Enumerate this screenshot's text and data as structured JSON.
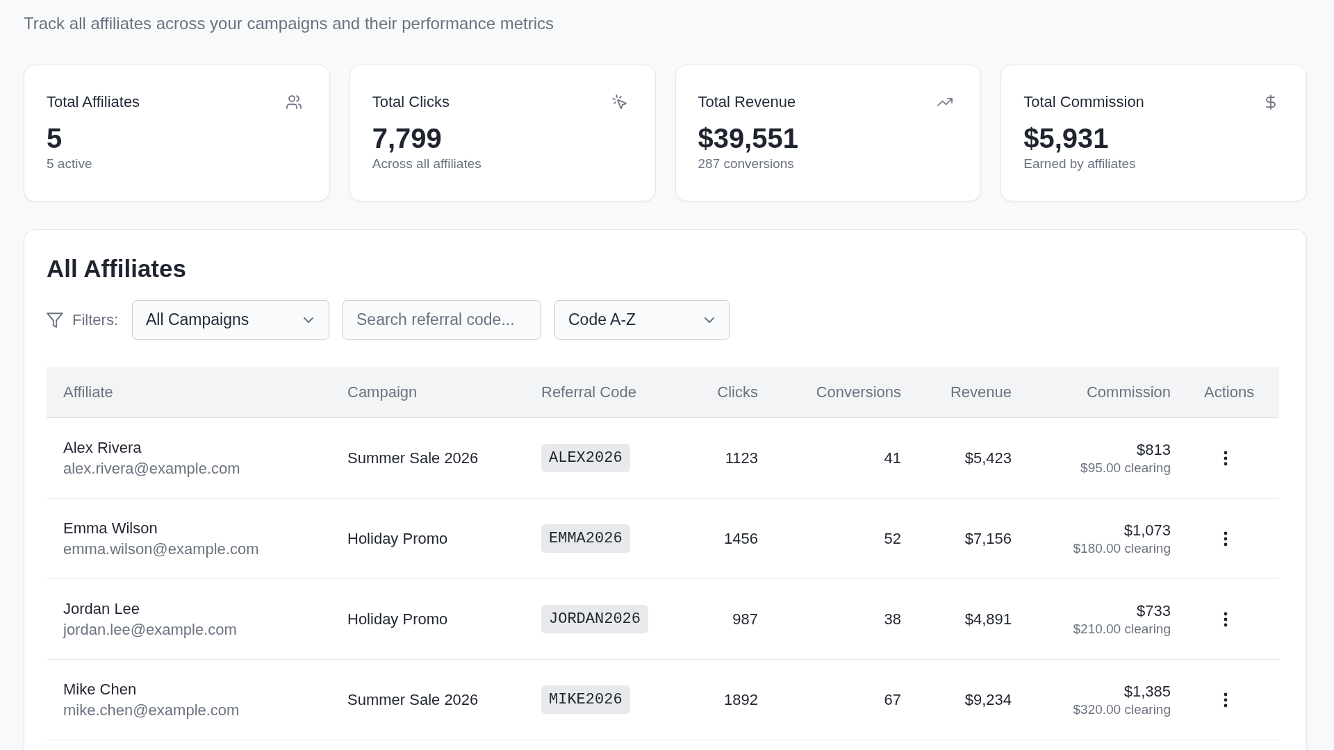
{
  "header": {
    "subtitle": "Track all affiliates across your campaigns and their performance metrics"
  },
  "stats": [
    {
      "kind": "affiliates",
      "label": "Total Affiliates",
      "value": "5",
      "note": "5 active"
    },
    {
      "kind": "clicks",
      "label": "Total Clicks",
      "value": "7,799",
      "note": "Across all affiliates"
    },
    {
      "kind": "revenue",
      "label": "Total Revenue",
      "value": "$39,551",
      "note": "287 conversions"
    },
    {
      "kind": "commission",
      "label": "Total Commission",
      "value": "$5,931",
      "note": "Earned by affiliates"
    }
  ],
  "affiliates": {
    "title": "All Affiliates",
    "filters": {
      "label": "Filters:",
      "campaign": {
        "value": "All Campaigns"
      },
      "search": {
        "placeholder": "Search referral code..."
      },
      "sort": {
        "value": "Code A-Z"
      }
    },
    "table": {
      "columns": [
        "Affiliate",
        "Campaign",
        "Referral Code",
        "Clicks",
        "Conversions",
        "Revenue",
        "Commission",
        "Actions"
      ],
      "rows": [
        {
          "name": "Alex Rivera",
          "email": "alex.rivera@example.com",
          "campaign": "Summer Sale 2026",
          "code": "ALEX2026",
          "clicks": "1123",
          "conversions": "41",
          "revenue": "$5,423",
          "commission": "$813",
          "clearing": "$95.00 clearing"
        },
        {
          "name": "Emma Wilson",
          "email": "emma.wilson@example.com",
          "campaign": "Holiday Promo",
          "code": "EMMA2026",
          "clicks": "1456",
          "conversions": "52",
          "revenue": "$7,156",
          "commission": "$1,073",
          "clearing": "$180.00 clearing"
        },
        {
          "name": "Jordan Lee",
          "email": "jordan.lee@example.com",
          "campaign": "Holiday Promo",
          "code": "JORDAN2026",
          "clicks": "987",
          "conversions": "38",
          "revenue": "$4,891",
          "commission": "$733",
          "clearing": "$210.00 clearing"
        },
        {
          "name": "Mike Chen",
          "email": "mike.chen@example.com",
          "campaign": "Summer Sale 2026",
          "code": "MIKE2026",
          "clicks": "1892",
          "conversions": "67",
          "revenue": "$9,234",
          "commission": "$1,385",
          "clearing": "$320.00 clearing"
        }
      ]
    }
  }
}
